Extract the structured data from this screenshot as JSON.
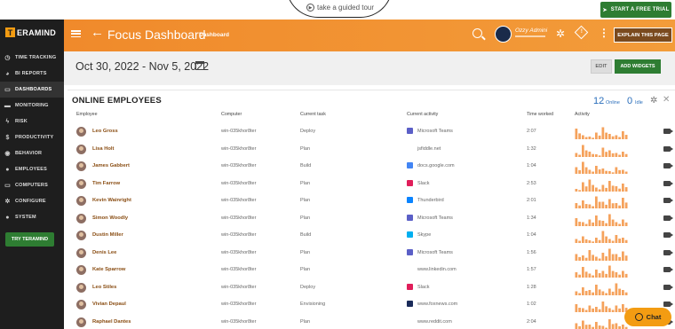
{
  "topbar": {
    "tour_text": "take a guided tour",
    "trial_button": "START A FREE TRIAL"
  },
  "brand": {
    "logo_text": "ERAMIND",
    "logo_letter": "T"
  },
  "sidebar": {
    "items": [
      {
        "label": "TIME TRACKING",
        "icon": "clock-icon",
        "glyph": "◷"
      },
      {
        "label": "BI REPORTS",
        "icon": "pie-chart-icon",
        "glyph": "◕"
      },
      {
        "label": "DASHBOARDS",
        "icon": "dashboard-icon",
        "glyph": "▭"
      },
      {
        "label": "MONITORING",
        "icon": "monitor-icon",
        "glyph": "▬"
      },
      {
        "label": "RISK",
        "icon": "lightning-icon",
        "glyph": "ϟ"
      },
      {
        "label": "PRODUCTIVITY",
        "icon": "dollar-icon",
        "glyph": "$"
      },
      {
        "label": "BEHAVIOR",
        "icon": "eye-icon",
        "glyph": "◉"
      },
      {
        "label": "EMPLOYEES",
        "icon": "users-icon",
        "glyph": "●"
      },
      {
        "label": "COMPUTERS",
        "icon": "computer-icon",
        "glyph": "▭"
      },
      {
        "label": "CONFIGURE",
        "icon": "gears-icon",
        "glyph": "✲"
      },
      {
        "label": "SYSTEM",
        "icon": "user-icon",
        "glyph": "●"
      }
    ],
    "active_index": 2,
    "try_button": "TRY TERAMIND"
  },
  "header": {
    "title": "Focus Dashboard",
    "badge": "Dashboard",
    "user_name": "Ozzy Admini",
    "explain_button": "EXPLAIN THIS PAGE"
  },
  "datebar": {
    "range": "Oct 30, 2022 - Nov 5, 2022",
    "edit_button": "EDIT",
    "add_widgets_button": "ADD WIDGETS"
  },
  "panel": {
    "title": "ONLINE EMPLOYEES",
    "online_count": "12",
    "online_label": "Online",
    "idle_count": "0",
    "idle_label": "Idle",
    "columns": [
      "Employee",
      "Computer",
      "Current task",
      "Current activity",
      "Time worked",
      "Activity"
    ],
    "rows": [
      {
        "name": "Leo Gross",
        "computer": "win-035khor8ter",
        "task": "Deploy",
        "activity": "Microsoft Teams",
        "icon_color": "#5b5fc7",
        "time": "2:07",
        "bars": [
          0.8,
          0.3,
          0.2,
          0.5,
          0.9,
          0.4,
          0.3,
          0.6
        ]
      },
      {
        "name": "Lisa Holt",
        "computer": "win-035khor8ter",
        "task": "Plan",
        "activity": "jsfiddle.net",
        "icon_color": "",
        "time": "1:32",
        "bars": [
          0.3,
          0.9,
          0.4,
          0.2,
          0.7,
          0.5,
          0.3,
          0.4
        ]
      },
      {
        "name": "James Gabbert",
        "computer": "win-035khor8ter",
        "task": "Build",
        "activity": "docs.google.com",
        "icon_color": "#4285f4",
        "time": "1:04",
        "bars": [
          0.5,
          0.9,
          0.3,
          0.6,
          0.4,
          0.2,
          0.5,
          0.3
        ]
      },
      {
        "name": "Tim Farrow",
        "computer": "win-035khor8ter",
        "task": "Plan",
        "activity": "Slack",
        "icon_color": "#e01e5a",
        "time": "2:53",
        "bars": [
          0.2,
          0.7,
          0.9,
          0.3,
          0.5,
          0.8,
          0.4,
          0.6
        ]
      },
      {
        "name": "Kevin Wainright",
        "computer": "win-035khor8ter",
        "task": "Plan",
        "activity": "Thunderbird",
        "icon_color": "#0a84ff",
        "time": "2:01",
        "bars": [
          0.4,
          0.6,
          0.3,
          0.9,
          0.5,
          0.7,
          0.4,
          0.8
        ]
      },
      {
        "name": "Simon Woodly",
        "computer": "win-035khor8ter",
        "task": "Plan",
        "activity": "Microsoft Teams",
        "icon_color": "#5b5fc7",
        "time": "1:34",
        "bars": [
          0.6,
          0.3,
          0.5,
          0.8,
          0.4,
          0.9,
          0.3,
          0.5
        ]
      },
      {
        "name": "Dustin Miller",
        "computer": "win-035khor8ter",
        "task": "Build",
        "activity": "Skype",
        "icon_color": "#00aff0",
        "time": "1:04",
        "bars": [
          0.3,
          0.5,
          0.2,
          0.4,
          0.9,
          0.3,
          0.6,
          0.4
        ]
      },
      {
        "name": "Denis Lee",
        "computer": "win-035khor8ter",
        "task": "Plan",
        "activity": "Microsoft Teams",
        "icon_color": "#5b5fc7",
        "time": "1:56",
        "bars": [
          0.5,
          0.4,
          0.8,
          0.3,
          0.6,
          0.9,
          0.5,
          0.7
        ]
      },
      {
        "name": "Kate Sparrow",
        "computer": "win-035khor8ter",
        "task": "Plan",
        "activity": "www.linkedin.com",
        "icon_color": "",
        "time": "1:57",
        "bars": [
          0.4,
          0.8,
          0.3,
          0.6,
          0.5,
          0.9,
          0.4,
          0.5
        ]
      },
      {
        "name": "Leo Stiles",
        "computer": "win-035khor8ter",
        "task": "Deploy",
        "activity": "Slack",
        "icon_color": "#e01e5a",
        "time": "1:28",
        "bars": [
          0.3,
          0.6,
          0.4,
          0.8,
          0.3,
          0.5,
          0.9,
          0.4
        ]
      },
      {
        "name": "Vivian Depaul",
        "computer": "win-035khor8ter",
        "task": "Envisioning",
        "activity": "www.foxnews.com",
        "icon_color": "#1a2b5a",
        "time": "1:02",
        "bars": [
          0.6,
          0.3,
          0.5,
          0.4,
          0.8,
          0.3,
          0.5,
          0.6
        ]
      },
      {
        "name": "Raphael Dantes",
        "computer": "win-035khor8ter",
        "task": "Plan",
        "activity": "www.reddit.com",
        "icon_color": "",
        "time": "2:04",
        "bars": [
          0.5,
          0.7,
          0.4,
          0.6,
          0.3,
          0.8,
          0.5,
          0.4
        ]
      }
    ]
  },
  "chat": {
    "label": "Chat"
  },
  "colors": {
    "accent": "#f08a2b",
    "sidebar": "#1e1e1e",
    "green": "#2e7d32",
    "link": "#2a6ebb"
  }
}
